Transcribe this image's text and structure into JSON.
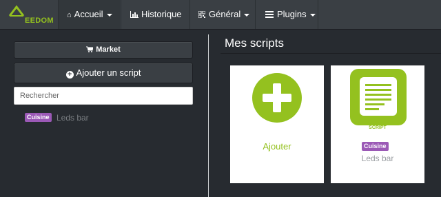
{
  "brand": {
    "logo_text": "EEDOM"
  },
  "nav": {
    "accueil": "Accueil",
    "historique": "Historique",
    "general": "Général",
    "plugins": "Plugins"
  },
  "left": {
    "market_label": "Market",
    "add_script_label": "Ajouter un script",
    "search_placeholder": "Rechercher",
    "scripts": [
      {
        "badge": "Cuisine",
        "name": "Leds bar"
      }
    ]
  },
  "right": {
    "title": "Mes scripts",
    "add_card_label": "Ajouter",
    "script_card": {
      "icon_caption": "SCRIPT",
      "badge": "Cuisine",
      "name": "Leds bar"
    }
  },
  "colors": {
    "accent": "#94c11f",
    "badge": "#9b59b6",
    "navbar": "#3a3f44",
    "background": "#272b30"
  }
}
